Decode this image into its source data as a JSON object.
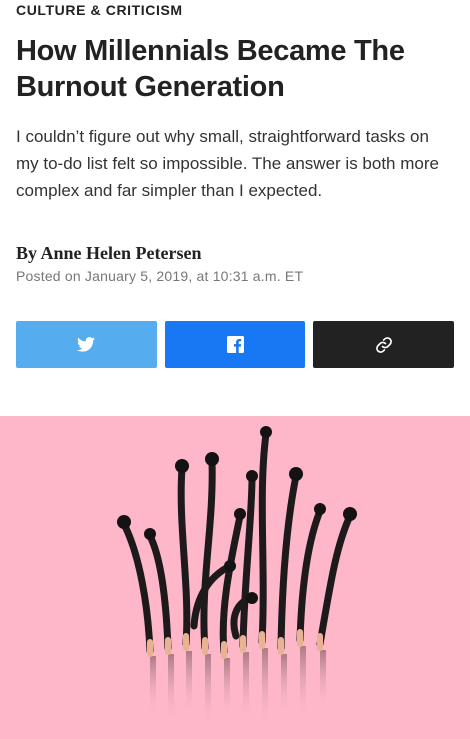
{
  "article": {
    "section": "CULTURE & CRITICISM",
    "headline": "How Millennials Became The Burnout Generation",
    "dek": "I couldn’t figure out why small, straightforward tasks on my to-do list felt so impossible. The answer is both more complex and far simpler than I expected.",
    "byline_prefix": "By ",
    "author": "Anne Helen Petersen",
    "posted": "Posted on January 5, 2019, at 10:31 a.m. ET"
  },
  "share": {
    "buttons": [
      {
        "name": "twitter",
        "icon": "twitter-bird-icon",
        "color": "#55acee"
      },
      {
        "name": "facebook",
        "icon": "facebook-f-icon",
        "color": "#1877f2"
      },
      {
        "name": "copy-link",
        "icon": "link-icon",
        "color": "#222222"
      }
    ]
  },
  "hero": {
    "description_icon": "burnt-matches-image",
    "background_color": "#fdb7c8"
  }
}
